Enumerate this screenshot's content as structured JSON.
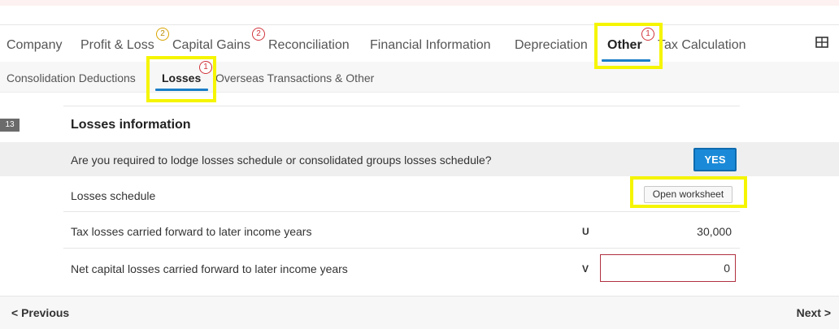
{
  "tabs": [
    {
      "label": "Company"
    },
    {
      "label": "Profit & Loss",
      "badge": "2"
    },
    {
      "label": "Capital Gains",
      "badge": "2"
    },
    {
      "label": "Reconciliation"
    },
    {
      "label": "Financial Information"
    },
    {
      "label": "Depreciation"
    },
    {
      "label": "Other",
      "badge": "1",
      "active": true
    },
    {
      "label": "Tax Calculation"
    }
  ],
  "subtabs": [
    {
      "label": "Consolidation Deductions"
    },
    {
      "label": "Losses",
      "badge": "1",
      "active": true
    },
    {
      "label": "Overseas Transactions & Other"
    }
  ],
  "section": {
    "number": "13",
    "title": "Losses information"
  },
  "rows": {
    "lodge_question": {
      "label": "Are you required to lodge losses schedule or consolidated groups losses schedule?",
      "answer": "YES"
    },
    "losses_schedule": {
      "label": "Losses schedule",
      "button": "Open worksheet"
    },
    "tax_losses": {
      "label": "Tax losses carried forward to later income years",
      "code": "U",
      "value": "30,000"
    },
    "net_capital_losses": {
      "label": "Net capital losses carried forward to later income years",
      "code": "V",
      "value": "0"
    }
  },
  "footer": {
    "previous": "< Previous",
    "next": "Next >"
  },
  "colors": {
    "accent": "#1a7ec8",
    "highlight": "#f5f500",
    "error_badge": "#d0343c",
    "warning_badge": "#d9a400"
  }
}
